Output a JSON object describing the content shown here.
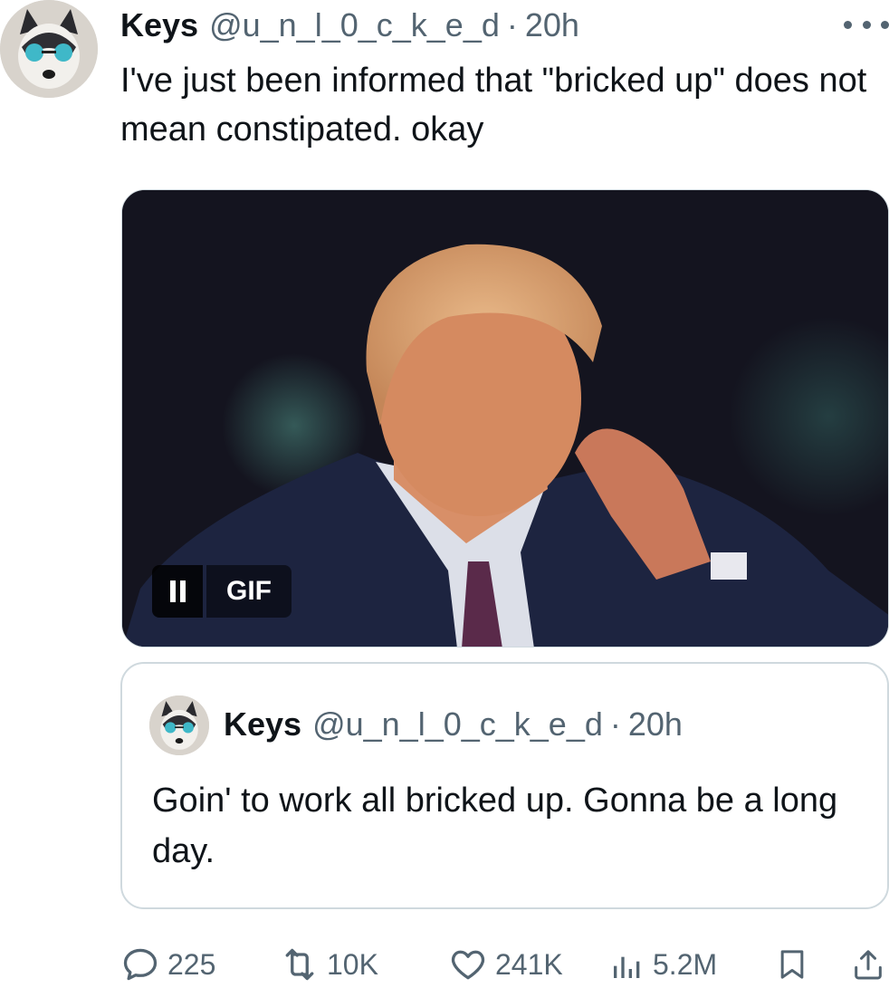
{
  "tweet": {
    "author": {
      "display_name": "Keys",
      "handle": "@u_n_l_0_c_k_e_d",
      "avatar_icon": "husky-dog-sunglasses-avatar"
    },
    "separator": "·",
    "time": "20h",
    "text": "I've just been informed that \"bricked up\" does not mean constipated. okay",
    "media": {
      "type": "gif",
      "badge_label": "GIF",
      "pause_icon": "pause-icon"
    },
    "quoted": {
      "author": {
        "display_name": "Keys",
        "handle": "@u_n_l_0_c_k_e_d",
        "avatar_icon": "husky-dog-sunglasses-avatar"
      },
      "time": "20h",
      "text": "Goin' to work all bricked up. Gonna be a long day."
    },
    "stats": {
      "replies": "225",
      "reposts": "10K",
      "likes": "241K",
      "views": "5.2M"
    }
  },
  "colors": {
    "text_primary": "#0f1419",
    "text_secondary": "#536471",
    "border": "#cfd9de"
  }
}
